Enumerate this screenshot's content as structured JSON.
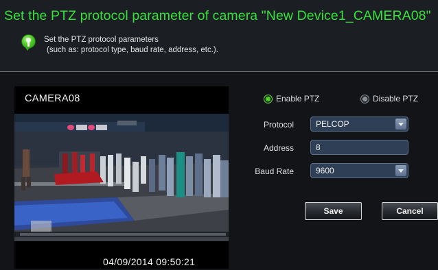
{
  "dialog": {
    "title": "Set the PTZ protocol parameter of camera \"New Device1_CAMERA08\"",
    "hint_line1": "Set the PTZ protocol parameters",
    "hint_line2": "(such as: protocol type, baud rate, address, etc.)."
  },
  "camera": {
    "name": "CAMERA08",
    "timestamp": "04/09/2014 09:50:21"
  },
  "ptz": {
    "enable_label": "Enable PTZ",
    "disable_label": "Disable PTZ",
    "enabled": true
  },
  "form": {
    "protocol_label": "Protocol",
    "protocol_value": "PELCOP",
    "address_label": "Address",
    "address_value": "8",
    "baud_label": "Baud Rate",
    "baud_value": "9600"
  },
  "buttons": {
    "save": "Save",
    "cancel": "Cancel"
  },
  "colors": {
    "title": "#35e13b",
    "dialog_bg": "#1b1e23",
    "input_bg": "#2f3f55",
    "radio_on": "#49d424"
  }
}
